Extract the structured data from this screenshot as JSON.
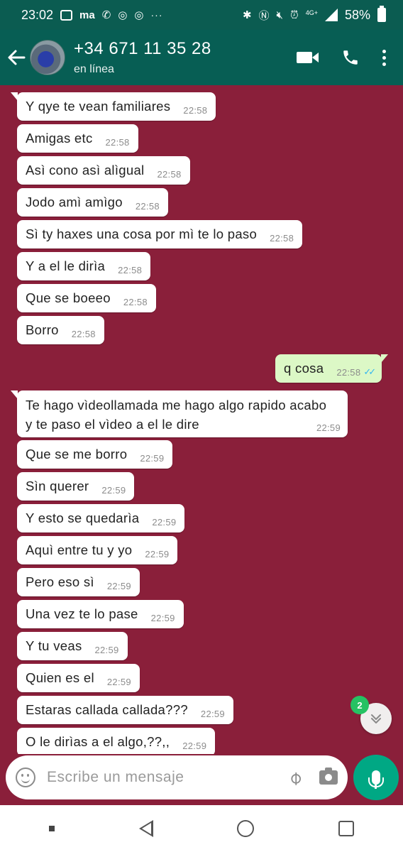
{
  "status_bar": {
    "time": "23:02",
    "app_ma": "ma",
    "more": "···",
    "network": "4G+",
    "battery": "58%"
  },
  "header": {
    "contact_name": "+34 671 11 35 28",
    "contact_status": "en línea"
  },
  "messages": [
    {
      "text": "Y qye te vean familiares",
      "time": "22:58",
      "dir": "in"
    },
    {
      "text": "Amigas etc",
      "time": "22:58",
      "dir": "in"
    },
    {
      "text": "Asì cono asì alìgual",
      "time": "22:58",
      "dir": "in"
    },
    {
      "text": "Jodo amì amìgo",
      "time": "22:58",
      "dir": "in"
    },
    {
      "text": "Sì ty haxes una cosa por mì te lo paso",
      "time": "22:58",
      "dir": "in"
    },
    {
      "text": "Y a el le dirìa",
      "time": "22:58",
      "dir": "in"
    },
    {
      "text": "Que se boeeo",
      "time": "22:58",
      "dir": "in"
    },
    {
      "text": "Borro",
      "time": "22:58",
      "dir": "in"
    },
    {
      "text": "q cosa",
      "time": "22:58",
      "dir": "out",
      "read": true
    },
    {
      "line1": "Te hago vìdeollamada me hago algo rapido acabo",
      "line2": "y te paso el vìdeo a el le dire",
      "time": "22:59",
      "dir": "in"
    },
    {
      "text": "Que se me borro",
      "time": "22:59",
      "dir": "in"
    },
    {
      "text": "Sìn querer",
      "time": "22:59",
      "dir": "in"
    },
    {
      "text": "Y esto se quedarìa",
      "time": "22:59",
      "dir": "in"
    },
    {
      "text": "Aquì entre tu y yo",
      "time": "22:59",
      "dir": "in"
    },
    {
      "text": "Pero eso sì",
      "time": "22:59",
      "dir": "in"
    },
    {
      "text": "Una vez te lo pase",
      "time": "22:59",
      "dir": "in"
    },
    {
      "text": "Y tu veas",
      "time": "22:59",
      "dir": "in"
    },
    {
      "text": "Quien es el",
      "time": "22:59",
      "dir": "in"
    },
    {
      "text": "Estaras callada callada???",
      "time": "22:59",
      "dir": "in"
    },
    {
      "text": "O le dirìas a el algo,??,,",
      "time": "22:59",
      "dir": "in"
    }
  ],
  "unread_count": "2",
  "input": {
    "placeholder": "Escribe un mensaje",
    "value": ""
  },
  "colors": {
    "header": "#075e54",
    "chat_background": "#8a1f3a",
    "outgoing_bubble": "#dcf8c6",
    "accent": "#00a884",
    "read_ticks": "#34b7f1"
  },
  "icons": [
    "back-arrow-icon",
    "video-call-icon",
    "phone-icon",
    "more-vert-icon",
    "emoji-icon",
    "attach-icon",
    "camera-icon",
    "mic-icon",
    "chevron-down-icon"
  ]
}
